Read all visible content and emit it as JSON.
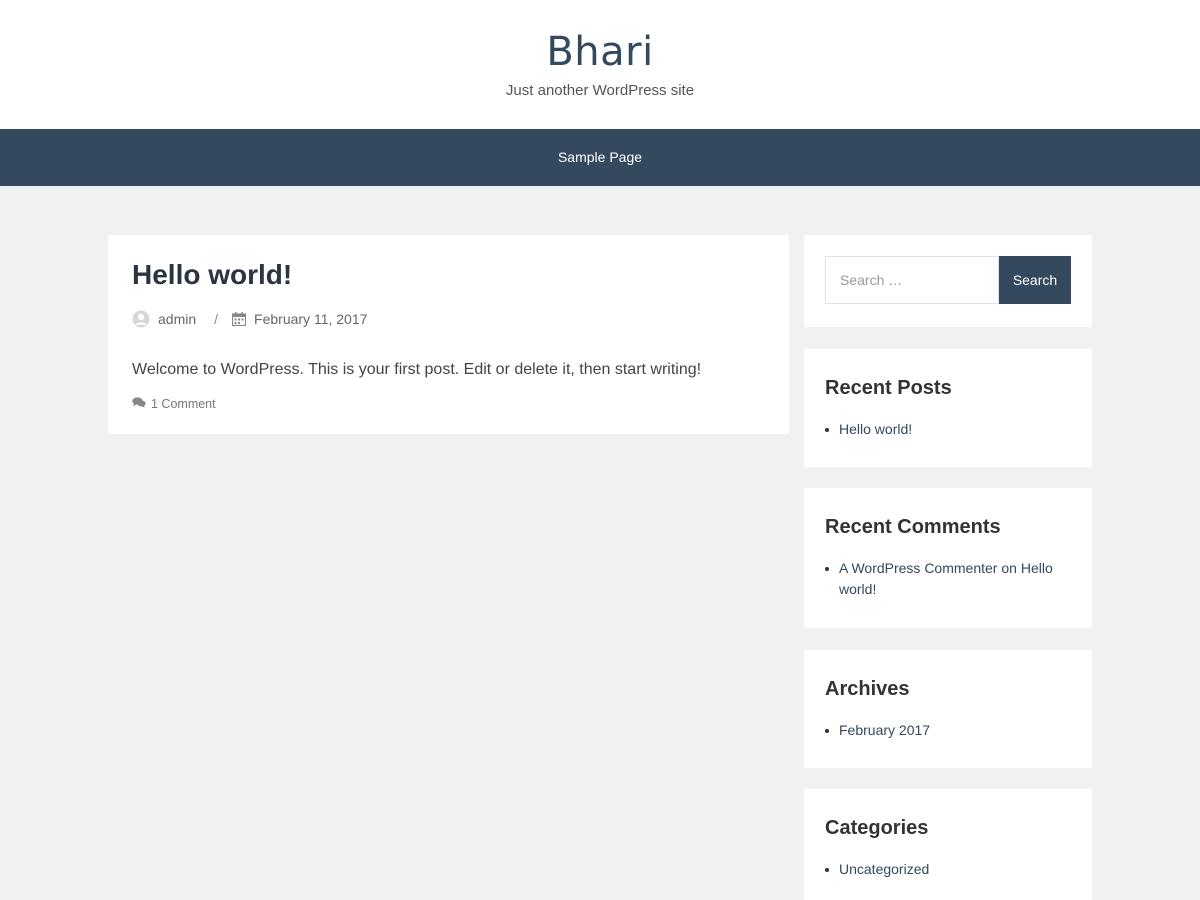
{
  "site": {
    "title": "Bhari",
    "description": "Just another WordPress site"
  },
  "nav": {
    "items": [
      {
        "label": "Sample Page"
      }
    ]
  },
  "post": {
    "title": "Hello world!",
    "author": "admin",
    "separator": "/",
    "date": "February 11, 2017",
    "excerpt": "Welcome to WordPress. This is your first post. Edit or delete it, then start writing!",
    "comments": "1 Comment"
  },
  "sidebar": {
    "search": {
      "placeholder": "Search …",
      "button_label": "Search"
    },
    "recent_posts": {
      "title": "Recent Posts",
      "items": [
        "Hello world!"
      ]
    },
    "recent_comments": {
      "title": "Recent Comments",
      "items": [
        {
          "author": "A WordPress Commenter",
          "on": "on",
          "post": "Hello world!"
        }
      ]
    },
    "archives": {
      "title": "Archives",
      "items": [
        "February 2017"
      ]
    },
    "categories": {
      "title": "Categories",
      "items": [
        "Uncategorized"
      ]
    }
  },
  "icons": {
    "author": "user-avatar-icon",
    "date": "calendar-icon",
    "comments": "comments-icon"
  },
  "colors": {
    "accent": "#34495e",
    "background": "#f1f1f1",
    "card": "#ffffff"
  }
}
